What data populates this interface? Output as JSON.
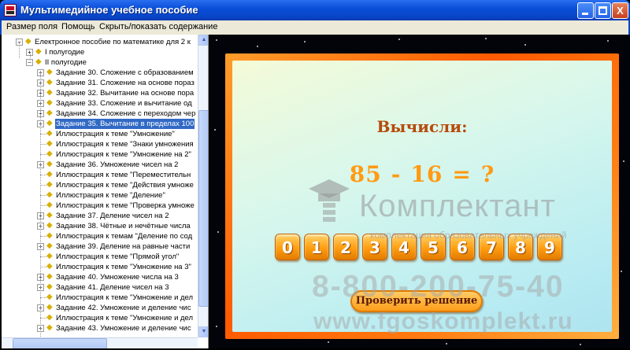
{
  "window": {
    "title": "Мультимедийное учебное пособие",
    "minimize_glyph": "_",
    "close_glyph": "X"
  },
  "menu": {
    "items": [
      "Размер поля",
      "Помощь",
      "Скрыть/показать содержание"
    ]
  },
  "tree": {
    "root": "Електронное пособие по математике для 2 к",
    "nodes": [
      {
        "label": "I полугодие",
        "level": 1,
        "expander": "+"
      },
      {
        "label": "II полугодие",
        "level": 1,
        "expander": "-"
      },
      {
        "label": "Задание 30. Сложение с образованием",
        "level": 2,
        "expander": "+"
      },
      {
        "label": "Задание 31. Сложение на основе пораз",
        "level": 2,
        "expander": "+"
      },
      {
        "label": "Задание 32. Вычитание на основе пора",
        "level": 2,
        "expander": "+"
      },
      {
        "label": "Задание 33. Сложение и вычитание од",
        "level": 2,
        "expander": "+"
      },
      {
        "label": "Задание 34. Сложение с переходом чер",
        "level": 2,
        "expander": "+"
      },
      {
        "label": "Задание 35. Вычитание в пределах 100",
        "level": 2,
        "expander": "+",
        "selected": true
      },
      {
        "label": "Иллюстрация к теме \"Умножение\"",
        "level": 2
      },
      {
        "label": "Иллюстрация к теме \"Знаки умножения",
        "level": 2
      },
      {
        "label": "Иллюстрация к теме \"Умножение на 2\"",
        "level": 2
      },
      {
        "label": "Задание 36. Умножение чисел на 2",
        "level": 2,
        "expander": "+"
      },
      {
        "label": "Иллюстрация к теме \"Переместительн",
        "level": 2
      },
      {
        "label": "Иллюстрация к теме \"Действия умноже",
        "level": 2
      },
      {
        "label": "Иллюстрация к теме \"Деление\"",
        "level": 2
      },
      {
        "label": "Иллюстрация к теме \"Проверка умноже",
        "level": 2
      },
      {
        "label": "Задание 37. Деление чисел на 2",
        "level": 2,
        "expander": "+"
      },
      {
        "label": "Задание 38. Чётные и нечётные числа",
        "level": 2,
        "expander": "+"
      },
      {
        "label": "Иллюстрация к темам \"Деление по сод",
        "level": 2
      },
      {
        "label": "Задание 39. Деление на равные части",
        "level": 2,
        "expander": "+"
      },
      {
        "label": "Иллюстрация к теме \"Прямой угол\"",
        "level": 2
      },
      {
        "label": "Иллюстрация к теме \"Умножение на 3\"",
        "level": 2
      },
      {
        "label": "Задание 40. Умножение числа на 3",
        "level": 2,
        "expander": "+"
      },
      {
        "label": "Задание 41. Деление чисел на 3",
        "level": 2,
        "expander": "+"
      },
      {
        "label": "Иллюстрация к теме \"Умножение и дел",
        "level": 2
      },
      {
        "label": "Задание 42. Умножение и деление чис",
        "level": 2,
        "expander": "+"
      },
      {
        "label": "Иллюстрация к теме \"Умножение и дел",
        "level": 2
      },
      {
        "label": "Задание 43. Умножение и деление чис",
        "level": 2,
        "expander": "+"
      }
    ]
  },
  "scroll": {
    "up": "▲",
    "down": "▼"
  },
  "task": {
    "prompt": "Вычисли:",
    "operand1": "85",
    "operator": "-",
    "operand2": "16",
    "equals": "=",
    "answer": "?",
    "digits": [
      "0",
      "1",
      "2",
      "3",
      "4",
      "5",
      "6",
      "7",
      "8",
      "9"
    ],
    "check_button": "Проверить решение"
  },
  "watermark": {
    "brand": "Комплектант",
    "tagline": "комплектация образовательных учреждений",
    "phone": "8-800-200-75-40",
    "url": "www.fgoskomplekt.ru"
  },
  "colors": {
    "title_bar": "#0846c8",
    "frame_orange": "#ff7a10",
    "digit_orange": "#ff9d10",
    "prompt_brown": "#b64a0a",
    "selection": "#316ac5"
  }
}
